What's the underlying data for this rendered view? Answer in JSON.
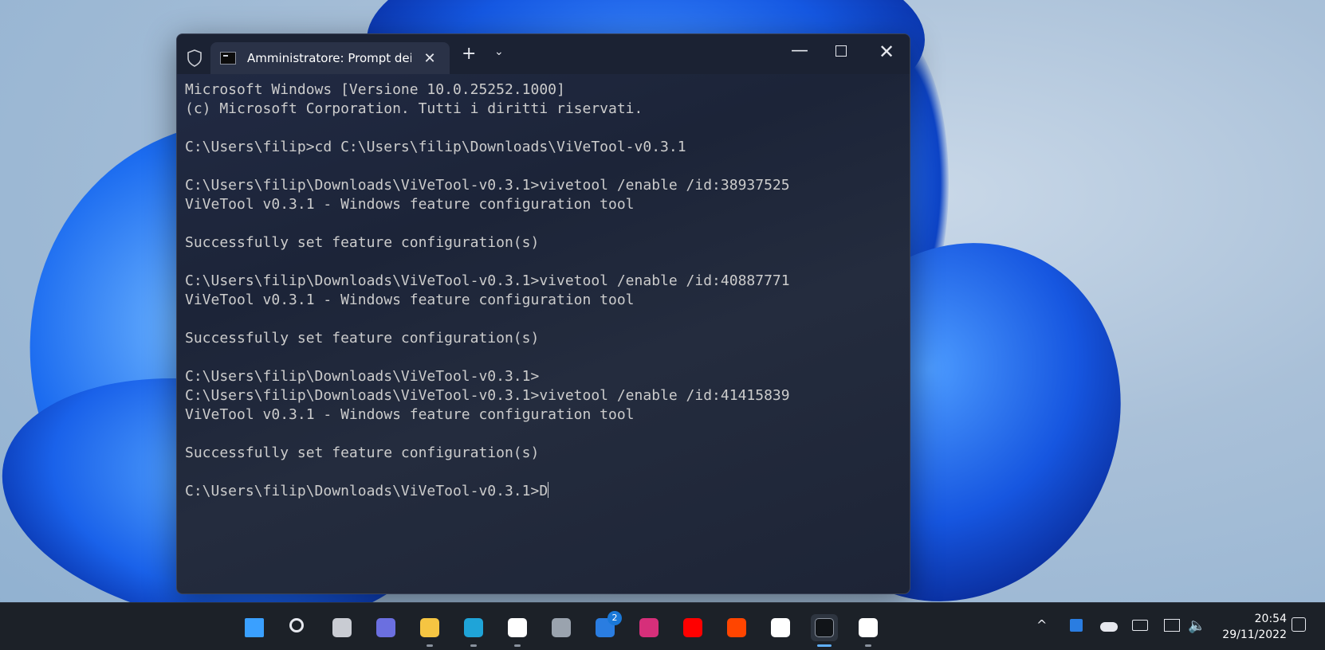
{
  "window": {
    "tab_title": "Amministratore: Prompt dei c",
    "tab_icon": "cmd-icon",
    "new_tab_glyph": "+",
    "dropdown_glyph": "⌄",
    "close_tab_glyph": "✕",
    "minimize_glyph": "—",
    "close_glyph": "✕"
  },
  "console": {
    "lines": [
      "Microsoft Windows [Versione 10.0.25252.1000]",
      "(c) Microsoft Corporation. Tutti i diritti riservati.",
      "",
      "C:\\Users\\filip>cd C:\\Users\\filip\\Downloads\\ViVeTool-v0.3.1",
      "",
      "C:\\Users\\filip\\Downloads\\ViVeTool-v0.3.1>vivetool /enable /id:38937525",
      "ViVeTool v0.3.1 - Windows feature configuration tool",
      "",
      "Successfully set feature configuration(s)",
      "",
      "C:\\Users\\filip\\Downloads\\ViVeTool-v0.3.1>vivetool /enable /id:40887771",
      "ViVeTool v0.3.1 - Windows feature configuration tool",
      "",
      "Successfully set feature configuration(s)",
      "",
      "C:\\Users\\filip\\Downloads\\ViVeTool-v0.3.1>",
      "C:\\Users\\filip\\Downloads\\ViVeTool-v0.3.1>vivetool /enable /id:41415839",
      "ViVeTool v0.3.1 - Windows feature configuration tool",
      "",
      "Successfully set feature configuration(s)",
      "",
      "C:\\Users\\filip\\Downloads\\ViVeTool-v0.3.1>D"
    ]
  },
  "taskbar": {
    "apps": [
      {
        "name": "start-icon",
        "color": "#3aa0ff"
      },
      {
        "name": "search-icon",
        "color": "#e6e8ee"
      },
      {
        "name": "task-view-icon",
        "color": "#c9ccd3"
      },
      {
        "name": "teams-chat-icon",
        "color": "#6b6fe0"
      },
      {
        "name": "file-explorer-icon",
        "color": "#f5c542"
      },
      {
        "name": "edge-icon",
        "color": "#1fa4d8"
      },
      {
        "name": "store-icon",
        "color": "#ffffff"
      },
      {
        "name": "settings-icon",
        "color": "#9aa3ae"
      },
      {
        "name": "todo-icon",
        "color": "#2a7de1"
      },
      {
        "name": "instagram-icon",
        "color": "#d62f7a"
      },
      {
        "name": "youtube-icon",
        "color": "#ff0000"
      },
      {
        "name": "reddit-icon",
        "color": "#ff4500"
      },
      {
        "name": "slack-icon",
        "color": "#ffffff"
      },
      {
        "name": "terminal-icon",
        "color": "#3b4250"
      },
      {
        "name": "sandbox-icon",
        "color": "#ffffff"
      }
    ],
    "badge_count": "2",
    "tray": {
      "chevron_glyph": "^"
    },
    "clock": {
      "time": "20:54",
      "date": "29/11/2022"
    }
  }
}
